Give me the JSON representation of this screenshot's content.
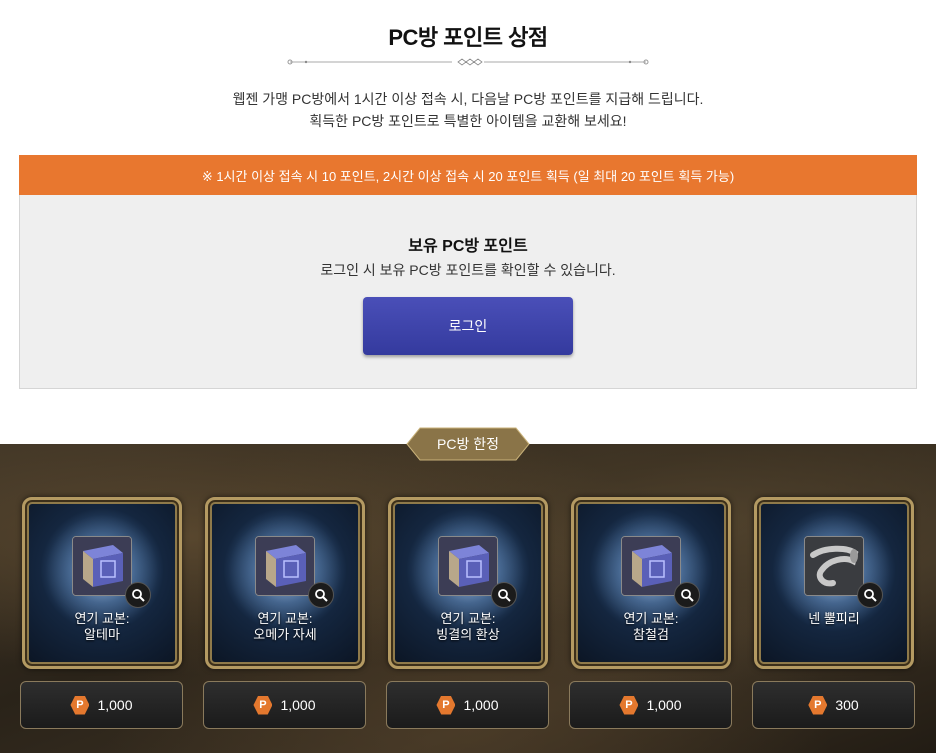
{
  "page": {
    "title": "PC방 포인트 상점",
    "intro_line1": "웹젠 가맹 PC방에서 1시간 이상 접속 시, 다음날 PC방 포인트를 지급해 드립니다.",
    "intro_line2": "획득한 PC방 포인트로 특별한 아이템을 교환해 보세요!"
  },
  "notice": {
    "bar_text": "※ 1시간 이상 접속 시 10 포인트, 2시간 이상 접속 시 20 포인트 획득 (일 최대 20 포인트 획득 가능)",
    "points_title": "보유 PC방 포인트",
    "points_desc": "로그인 시 보유 PC방 포인트를 확인할 수 있습니다.",
    "login_label": "로그인"
  },
  "shop": {
    "tag": "PC방 한정",
    "currency_icon": "P",
    "accent_color": "#e4782e",
    "items": [
      {
        "name_line1": "연기 교본:",
        "name_line2": "알테마",
        "price": "1,000",
        "icon": "book-icon"
      },
      {
        "name_line1": "연기 교본:",
        "name_line2": "오메가 자세",
        "price": "1,000",
        "icon": "book-icon"
      },
      {
        "name_line1": "연기 교본:",
        "name_line2": "빙결의 환상",
        "price": "1,000",
        "icon": "book-icon"
      },
      {
        "name_line1": "연기 교본:",
        "name_line2": "참철검",
        "price": "1,000",
        "icon": "book-icon"
      },
      {
        "name_line1": "넨 뿔피리",
        "name_line2": "",
        "price": "300",
        "icon": "horn-icon"
      }
    ]
  }
}
